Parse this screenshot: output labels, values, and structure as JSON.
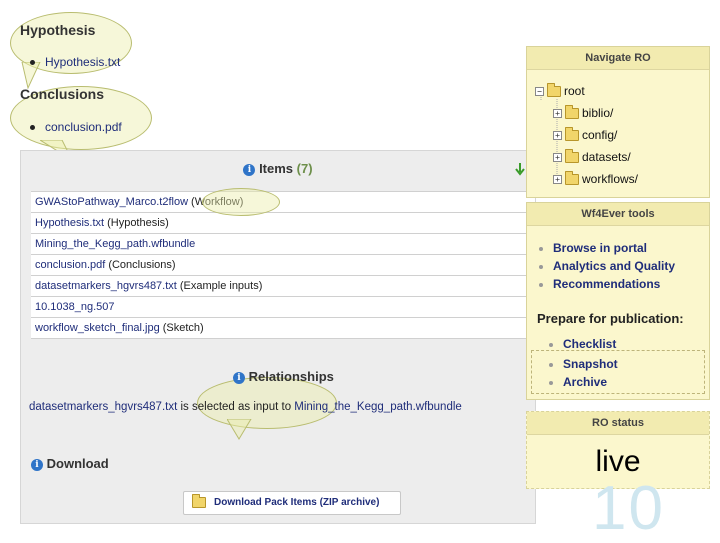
{
  "hypothesis": {
    "title": "Hypothesis",
    "file": "Hypothesis.txt"
  },
  "conclusions": {
    "title": "Conclusions",
    "file": "conclusion.pdf"
  },
  "items": {
    "title": "Items",
    "count": "(7)",
    "rows": [
      {
        "name": "GWAStoPathway_Marco.t2flow",
        "type": "(Workflow)"
      },
      {
        "name": "Hypothesis.txt",
        "type": "(Hypothesis)"
      },
      {
        "name": "Mining_the_Kegg_path.wfbundle",
        "type": ""
      },
      {
        "name": "conclusion.pdf",
        "type": "(Conclusions)"
      },
      {
        "name": "datasetmarkers_hgvrs487.txt",
        "type": "(Example inputs)"
      },
      {
        "name": "10.1038_ng.507",
        "type": ""
      },
      {
        "name": "workflow_sketch_final.jpg",
        "type": "(Sketch)"
      }
    ]
  },
  "relationships": {
    "title": "Relationships",
    "subject": "datasetmarkers_hgvrs487.txt",
    "predicate": " is selected as input to ",
    "object": "Mining_the_Kegg_path.wfbundle"
  },
  "download": {
    "title": "Download",
    "button": "Download Pack Items (ZIP archive)"
  },
  "navigate": {
    "title": "Navigate RO",
    "root": "root",
    "folders": [
      "biblio/",
      "config/",
      "datasets/",
      "workflows/"
    ]
  },
  "tools": {
    "title": "Wf4Ever tools",
    "items": [
      "Browse in portal",
      "Analytics and Quality",
      "Recommendations"
    ],
    "publication_title": "Prepare for publication:",
    "publication_items": [
      "Checklist",
      "Snapshot",
      "Archive"
    ]
  },
  "status": {
    "title": "RO status",
    "value": "live"
  },
  "slide_number": "10",
  "colors": {
    "link": "#1f2d7a",
    "panel": "#ededed",
    "side_box": "#fbf7cd",
    "bubble": "#eceeaa",
    "info_icon": "#2f74c8"
  }
}
